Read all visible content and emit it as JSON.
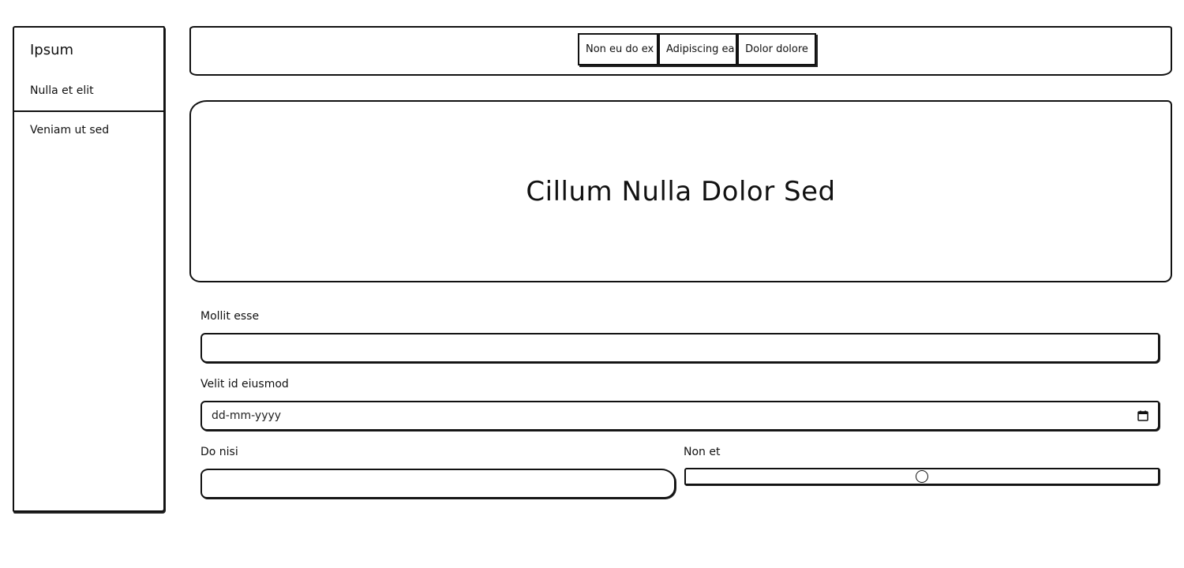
{
  "sidebar": {
    "brand": "Ipsum",
    "items": [
      {
        "label": "Nulla et elit"
      },
      {
        "label": "Veniam ut sed"
      }
    ]
  },
  "navbar": {
    "buttons": [
      {
        "label": "Non eu do ex"
      },
      {
        "label": "Adipiscing ea"
      },
      {
        "label": "Dolor dolore"
      }
    ]
  },
  "hero": {
    "title": "Cillum Nulla Dolor Sed"
  },
  "form": {
    "mollit_esse": {
      "label": "Mollit esse",
      "value": ""
    },
    "velit_id_eiusmod": {
      "label": "Velit id eiusmod",
      "placeholder": "dd-mm-yyyy"
    },
    "do_nisi": {
      "label": "Do nisi",
      "value": ""
    },
    "non_et": {
      "label": "Non et",
      "value_fraction": 0.5
    }
  },
  "icons": {
    "calendar": "calendar-icon"
  }
}
